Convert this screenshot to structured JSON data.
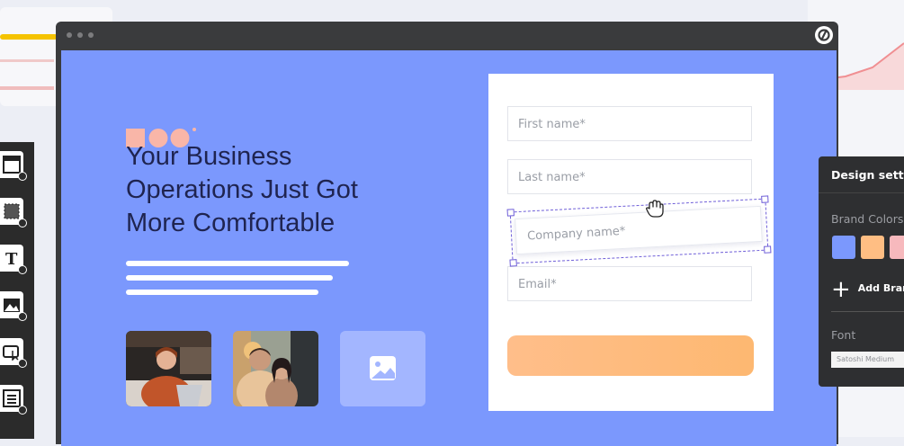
{
  "hero": {
    "headline": "Your Business Operations Just Got More Comfortable"
  },
  "form": {
    "first_name_placeholder": "First name*",
    "last_name_placeholder": "Last name*",
    "company_name_placeholder": "Company name*",
    "email_placeholder": "Email*"
  },
  "design_settings": {
    "title": "Design settin",
    "brand_colors_label": "Brand Colors",
    "swatches": [
      "#7b98fd",
      "#ffbe83",
      "#f7b9bd"
    ],
    "add_brand_label": "Add Bran",
    "font_label": "Font",
    "font_value": "Satoshi Medium"
  },
  "colors": {
    "canvas": "#7b98fd",
    "headline": "#1f2450",
    "accent_orange": "#fdb871",
    "selection": "#6f5fd8"
  },
  "icons": {
    "palette": [
      "layout-icon",
      "section-icon",
      "text-icon",
      "image-icon",
      "button-icon",
      "form-icon"
    ],
    "cursor": "hand-grab-cursor-icon",
    "placeholder": "image-placeholder-icon"
  }
}
